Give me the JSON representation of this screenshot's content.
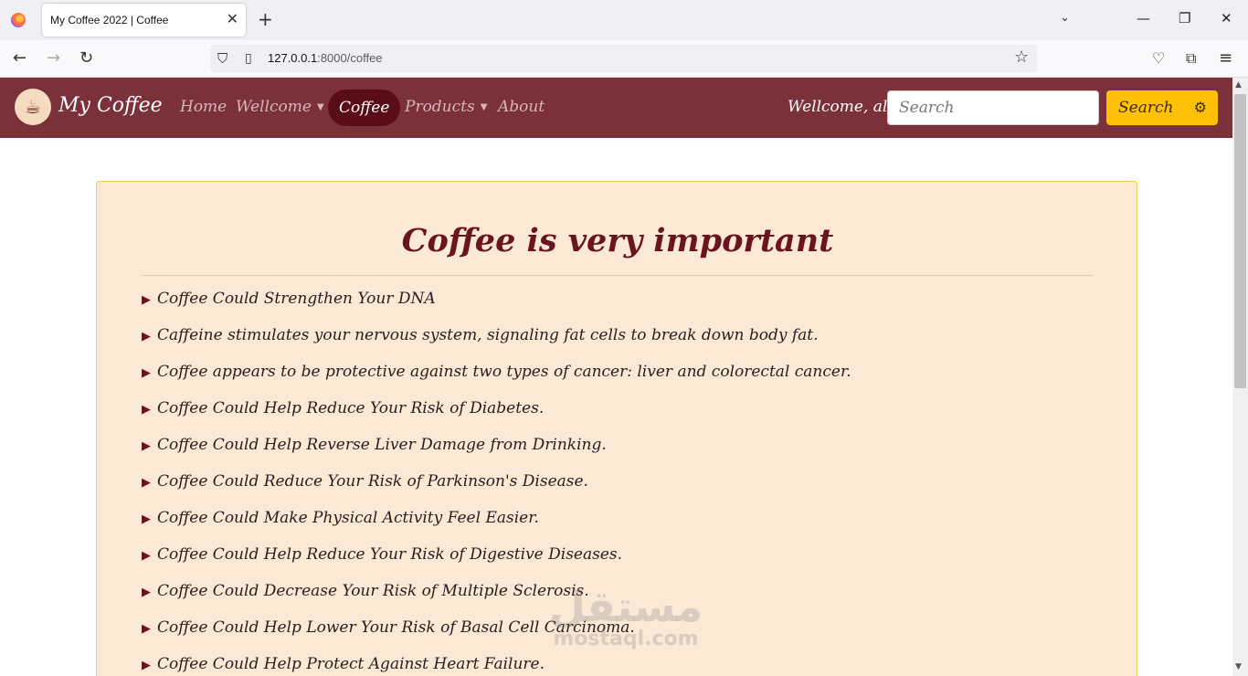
{
  "browser": {
    "tab_title": "My Coffee 2022 | Coffee",
    "url_host": "127.0.0.1",
    "url_rest": ":8000/coffee"
  },
  "site": {
    "brand": "My Coffee",
    "nav": {
      "home": "Home",
      "welcome": "Wellcome",
      "coffee": "Coffee",
      "products": "Products",
      "about": "About"
    },
    "greeting": "Wellcome, ali",
    "search_placeholder": "Search",
    "search_button": "Search"
  },
  "content": {
    "title": "Coffee is very important",
    "facts": [
      "Coffee Could Strengthen Your DNA",
      "Caffeine stimulates your nervous system, signaling fat cells to break down body fat.",
      "Coffee appears to be protective against two types of cancer: liver and colorectal cancer.",
      "Coffee Could Help Reduce Your Risk of Diabetes.",
      "Coffee Could Help Reverse Liver Damage from Drinking.",
      "Coffee Could Reduce Your Risk of Parkinson's Disease.",
      "Coffee Could Make Physical Activity Feel Easier.",
      "Coffee Could Help Reduce Your Risk of Digestive Diseases.",
      "Coffee Could Decrease Your Risk of Multiple Sclerosis.",
      "Coffee Could Help Lower Your Risk of Basal Cell Carcinoma.",
      "Coffee Could Help Protect Against Heart Failure."
    ]
  },
  "watermark": {
    "arabic": "مستقل",
    "latin": "mostaql.com"
  },
  "colors": {
    "nav_bg": "#7b313a",
    "active_pill": "#5a0d16",
    "card_bg": "#fbe9d6",
    "card_border": "#f3c75b",
    "search_button": "#ffc107",
    "title": "#6b141e"
  }
}
